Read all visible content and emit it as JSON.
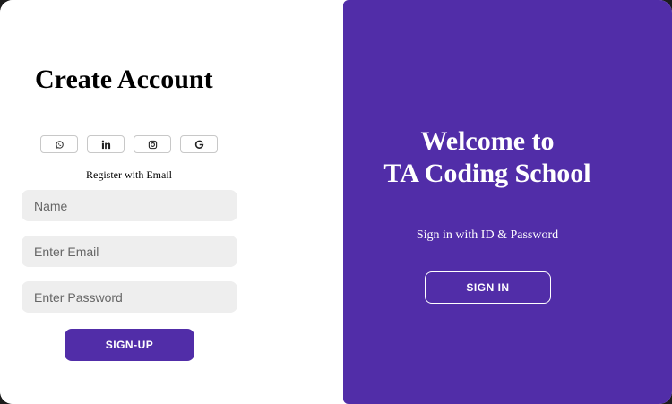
{
  "signup": {
    "title": "Create Account",
    "social_icons": [
      "whatsapp-icon",
      "linkedin-icon",
      "instagram-icon",
      "google-icon"
    ],
    "subtitle": "Register with Email",
    "name_placeholder": "Name",
    "email_placeholder": "Enter Email",
    "password_placeholder": "Enter Password",
    "button_label": "SIGN-UP"
  },
  "panel": {
    "welcome_line1": "Welcome to",
    "welcome_line2": "TA Coding School",
    "subtitle": "Sign in with ID & Password",
    "button_label": "SIGN IN"
  },
  "colors": {
    "accent": "#512da8",
    "field_bg": "#eeeeee",
    "text": "#000000"
  }
}
